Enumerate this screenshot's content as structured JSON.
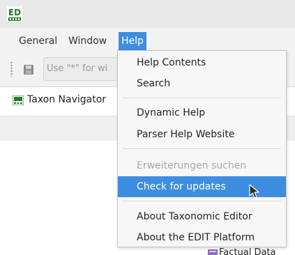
{
  "app": {
    "logo_text": "ED"
  },
  "menubar": {
    "items": [
      {
        "label": "General"
      },
      {
        "label": "Window"
      },
      {
        "label": "Help"
      }
    ]
  },
  "toolbar": {
    "search_placeholder": "Use \"*\" for wi"
  },
  "navigator": {
    "title": "Taxon Navigator"
  },
  "bottom_panel": {
    "title": "Factual Data"
  },
  "help_menu": {
    "items": [
      {
        "label": "Help Contents",
        "enabled": true
      },
      {
        "label": "Search",
        "enabled": true
      },
      {
        "label": "Dynamic Help",
        "enabled": true
      },
      {
        "label": "Parser Help Website",
        "enabled": true
      },
      {
        "label": "Erweiterungen suchen",
        "enabled": false
      },
      {
        "label": "Check for updates",
        "enabled": true,
        "highlighted": true
      },
      {
        "label": "About Taxonomic Editor",
        "enabled": true
      },
      {
        "label": "About the EDIT Platform",
        "enabled": true
      }
    ]
  },
  "colors": {
    "accent": "#3d8ee0",
    "menubar_bg": "#f2f2f2",
    "disabled_text": "#a8a8a8"
  }
}
